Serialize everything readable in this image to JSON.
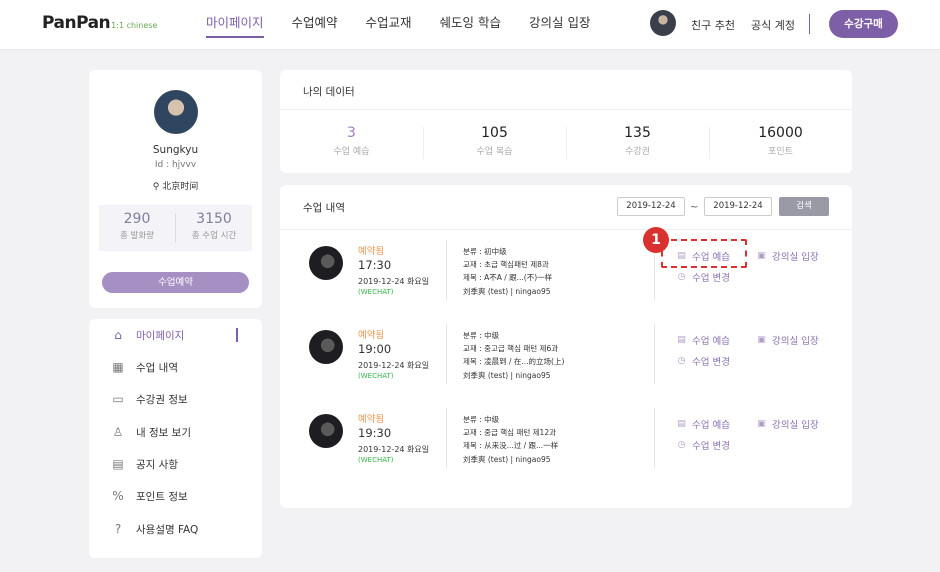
{
  "header": {
    "logo": "PanPan",
    "logo_sub": "1:1 chinese",
    "nav": [
      "마이페이지",
      "수업예약",
      "수업교재",
      "쉐도잉 학습",
      "강의실 입장"
    ],
    "friend_link": "친구 추천",
    "official_link": "공식 계정",
    "buy_button": "수강구매"
  },
  "profile": {
    "name": "Sungkyu",
    "id": "Id : hjvvv",
    "timezone": "北京时间",
    "stats": [
      {
        "value": "290",
        "label": "총 발화량"
      },
      {
        "value": "3150",
        "label": "총 수업 시간"
      }
    ],
    "book_button": "수업예약"
  },
  "menu": [
    {
      "label": "마이페이지",
      "icon": "home-icon"
    },
    {
      "label": "수업 내역",
      "icon": "calendar-icon"
    },
    {
      "label": "수강권 정보",
      "icon": "ticket-icon"
    },
    {
      "label": "내 정보 보기",
      "icon": "user-icon"
    },
    {
      "label": "공지 사항",
      "icon": "notice-icon"
    },
    {
      "label": "포인트 정보",
      "icon": "percent-icon"
    },
    {
      "label": "사용설명 FAQ",
      "icon": "question-icon"
    }
  ],
  "my_data": {
    "title": "나의 데이터",
    "metrics": [
      {
        "value": "3",
        "label": "수업 예습"
      },
      {
        "value": "105",
        "label": "수업 복습"
      },
      {
        "value": "135",
        "label": "수강권"
      },
      {
        "value": "16000",
        "label": "포인트"
      }
    ]
  },
  "history": {
    "title": "수업 내역",
    "date_from": "2019-12-24",
    "date_sep": "~",
    "date_to": "2019-12-24",
    "search_button": "검색",
    "lessons": [
      {
        "status": "예약됨",
        "time": "17:30",
        "date": "2019-12-24 화요일",
        "channel": "(WECHAT)",
        "category": "분류 : 初中级",
        "textbook": "교재 : 초급 핵심패턴 제8과",
        "subject": "제목 :  A不A / 跟...(不)一样",
        "teacher": "刘季爽 (test)  |  ningao95",
        "preview": "수업 예습",
        "enter": "강의실 입장",
        "change": "수업 변경"
      },
      {
        "status": "예약됨",
        "time": "19:00",
        "date": "2019-12-24 화요일",
        "channel": "(WECHAT)",
        "category": "분류 : 中级",
        "textbook": "교재 : 중고급 핵심 패턴 제6과",
        "subject": "제목 :  凌晨到 / 在...的立场(上)",
        "teacher": "刘季爽 (test)  |  ningao95",
        "preview": "수업 예습",
        "enter": "강의실 입장",
        "change": "수업 변경"
      },
      {
        "status": "예약됨",
        "time": "19:30",
        "date": "2019-12-24 화요일",
        "channel": "(WECHAT)",
        "category": "분류 : 中级",
        "textbook": "교재 : 중급 핵심 패턴 제12과",
        "subject": "제목 :  从来没...过 / 跟...一样",
        "teacher": "刘季爽 (test)  |  ningao95",
        "preview": "수업 예습",
        "enter": "강의실 입장",
        "change": "수업 변경"
      }
    ]
  },
  "annotation": {
    "badge": "1"
  }
}
